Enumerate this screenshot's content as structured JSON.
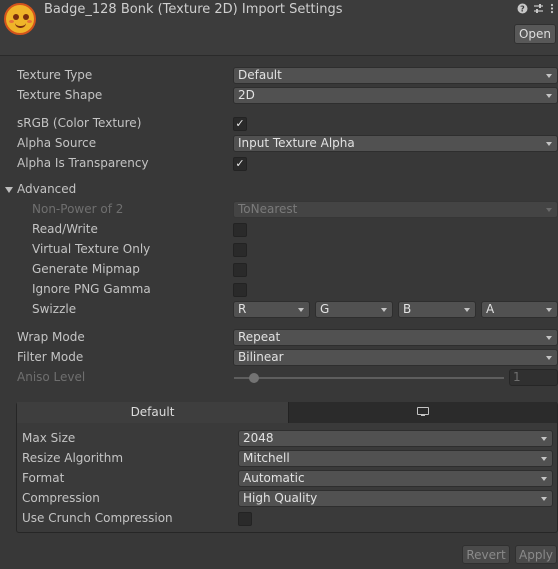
{
  "header": {
    "title": "Badge_128 Bonk (Texture 2D) Import Settings",
    "icons": [
      "help-icon",
      "presets-icon",
      "more-icon"
    ],
    "open_label": "Open"
  },
  "settings": {
    "texture_type": {
      "label": "Texture Type",
      "value": "Default"
    },
    "texture_shape": {
      "label": "Texture Shape",
      "value": "2D"
    },
    "srgb": {
      "label": "sRGB (Color Texture)",
      "checked": true
    },
    "alpha_source": {
      "label": "Alpha Source",
      "value": "Input Texture Alpha"
    },
    "alpha_transparency": {
      "label": "Alpha Is Transparency",
      "checked": true
    },
    "advanced": {
      "label": "Advanced",
      "expanded": true,
      "non_power_of_2": {
        "label": "Non-Power of 2",
        "value": "ToNearest",
        "disabled": true
      },
      "read_write": {
        "label": "Read/Write",
        "checked": false
      },
      "virtual_texture": {
        "label": "Virtual Texture Only",
        "checked": false
      },
      "generate_mipmap": {
        "label": "Generate Mipmap",
        "checked": false
      },
      "ignore_png_gamma": {
        "label": "Ignore PNG Gamma",
        "checked": false
      },
      "swizzle": {
        "label": "Swizzle",
        "r": "R",
        "g": "G",
        "b": "B",
        "a": "A"
      }
    },
    "wrap_mode": {
      "label": "Wrap Mode",
      "value": "Repeat"
    },
    "filter_mode": {
      "label": "Filter Mode",
      "value": "Bilinear"
    },
    "aniso_level": {
      "label": "Aniso Level",
      "value": "1",
      "disabled": true
    }
  },
  "platform": {
    "tabs": [
      {
        "label": "Default",
        "active": true
      },
      {
        "label": "",
        "icon": "monitor-icon",
        "active": false
      }
    ],
    "max_size": {
      "label": "Max Size",
      "value": "2048"
    },
    "resize_algorithm": {
      "label": "Resize Algorithm",
      "value": "Mitchell"
    },
    "format": {
      "label": "Format",
      "value": "Automatic"
    },
    "compression": {
      "label": "Compression",
      "value": "High Quality"
    },
    "crunch": {
      "label": "Use Crunch Compression",
      "checked": false
    }
  },
  "footer": {
    "revert_label": "Revert",
    "apply_label": "Apply"
  }
}
